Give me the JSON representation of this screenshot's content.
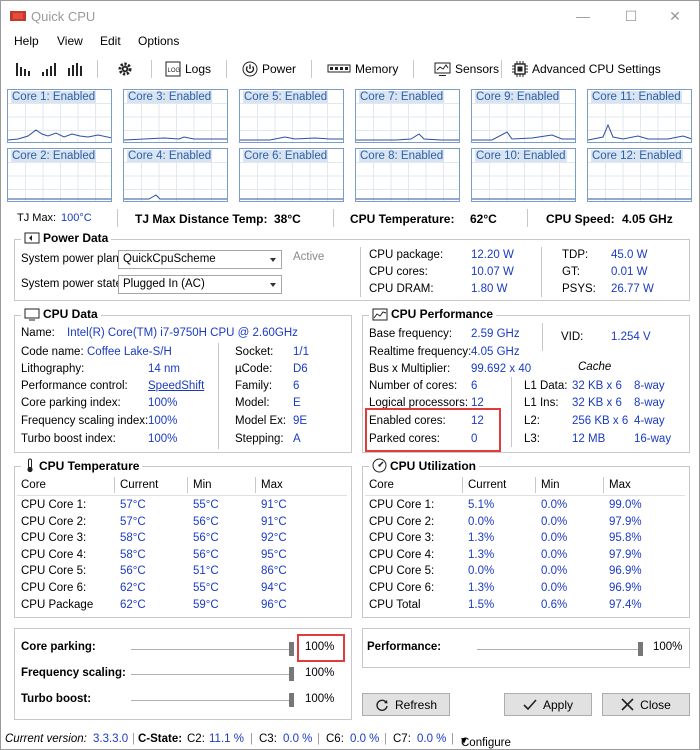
{
  "app": {
    "title": "Quick CPU"
  },
  "window_buttons": {
    "minimize": "—",
    "maximize": "☐",
    "close": "✕"
  },
  "menu": [
    "Help",
    "View",
    "Edit",
    "Options"
  ],
  "toolbar": {
    "logs": "Logs",
    "power": "Power",
    "memory": "Memory",
    "sensors": "Sensors",
    "advanced": "Advanced CPU Settings"
  },
  "cores": [
    {
      "label": "Core 1: Enabled"
    },
    {
      "label": "Core 3: Enabled"
    },
    {
      "label": "Core 5: Enabled"
    },
    {
      "label": "Core 7: Enabled"
    },
    {
      "label": "Core 9: Enabled"
    },
    {
      "label": "Core 11: Enabled"
    },
    {
      "label": "Core 2: Enabled"
    },
    {
      "label": "Core 4: Enabled"
    },
    {
      "label": "Core 6: Enabled"
    },
    {
      "label": "Core 8: Enabled"
    },
    {
      "label": "Core 10: Enabled"
    },
    {
      "label": "Core 12: Enabled"
    }
  ],
  "stats": {
    "tjmax_label": "TJ Max:",
    "tjmax_value": "100°C",
    "tjdist_label": "TJ Max Distance Temp:",
    "tjdist_value": "38°C",
    "cputemp_label": "CPU Temperature:",
    "cputemp_value": "62°C",
    "cpuspeed_label": "CPU Speed:",
    "cpuspeed_value": "4.05 GHz"
  },
  "power": {
    "title": "Power Data",
    "plan_label": "System power plan:",
    "plan_value": "QuickCpuScheme",
    "plan_status": "Active",
    "state_label": "System power state:",
    "state_value": "Plugged In (AC)",
    "pkg_label": "CPU package:",
    "pkg_value": "12.20 W",
    "cores_label": "CPU cores:",
    "cores_value": "10.07 W",
    "dram_label": "CPU DRAM:",
    "dram_value": "1.80 W",
    "tdp_label": "TDP:",
    "tdp_value": "45.0 W",
    "gt_label": "GT:",
    "gt_value": "0.01 W",
    "psys_label": "PSYS:",
    "psys_value": "26.77 W"
  },
  "cpudata": {
    "title": "CPU Data",
    "name_label": "Name:",
    "name_value": "Intel(R) Core(TM) i7-9750H CPU @ 2.60GHz",
    "codename_label": "Code name:",
    "codename_value": "Coffee Lake-S/H",
    "litho_label": "Lithography:",
    "litho_value": "14 nm",
    "perfctl_label": "Performance control:",
    "perfctl_value": "SpeedShift",
    "parkidx_label": "Core parking index:",
    "parkidx_value": "100%",
    "freqidx_label": "Frequency scaling index:",
    "freqidx_value": "100%",
    "turboidx_label": "Turbo boost index:",
    "turboidx_value": "100%",
    "socket_label": "Socket:",
    "socket_value": "1/1",
    "ucode_label": "µCode:",
    "ucode_value": "D6",
    "family_label": "Family:",
    "family_value": "6",
    "model_label": "Model:",
    "model_value": "E",
    "modelex_label": "Model Ex:",
    "modelex_value": "9E",
    "stepping_label": "Stepping:",
    "stepping_value": "A"
  },
  "perf": {
    "title": "CPU Performance",
    "basefreq_label": "Base frequency:",
    "basefreq_value": "2.59 GHz",
    "rtfreq_label": "Realtime frequency:",
    "rtfreq_value": "4.05 GHz",
    "bus_label": "Bus x Multiplier:",
    "bus_value": "99.692 x 40",
    "ncores_label": "Number of cores:",
    "ncores_value": "6",
    "logical_label": "Logical processors:",
    "logical_value": "12",
    "enabled_label": "Enabled cores:",
    "enabled_value": "12",
    "parked_label": "Parked cores:",
    "parked_value": "0",
    "vid_label": "VID:",
    "vid_value": "1.254 V",
    "cache_title": "Cache",
    "l1d_label": "L1 Data:",
    "l1d_size": "32 KB x 6",
    "l1d_way": "8-way",
    "l1i_label": "L1 Ins:",
    "l1i_size": "32 KB x 6",
    "l1i_way": "8-way",
    "l2_label": "L2:",
    "l2_size": "256 KB x 6",
    "l2_way": "4-way",
    "l3_label": "L3:",
    "l3_size": "12 MB",
    "l3_way": "16-way"
  },
  "temp": {
    "title": "CPU Temperature",
    "headers": [
      "Core",
      "Current",
      "Min",
      "Max"
    ],
    "rows": [
      [
        "CPU Core 1:",
        "57°C",
        "55°C",
        "91°C"
      ],
      [
        "CPU Core 2:",
        "57°C",
        "56°C",
        "91°C"
      ],
      [
        "CPU Core 3:",
        "58°C",
        "56°C",
        "92°C"
      ],
      [
        "CPU Core 4:",
        "58°C",
        "56°C",
        "95°C"
      ],
      [
        "CPU Core 5:",
        "56°C",
        "51°C",
        "86°C"
      ],
      [
        "CPU Core 6:",
        "62°C",
        "55°C",
        "94°C"
      ],
      [
        "CPU Package",
        "62°C",
        "59°C",
        "96°C"
      ]
    ]
  },
  "util": {
    "title": "CPU Utilization",
    "headers": [
      "Core",
      "Current",
      "Min",
      "Max"
    ],
    "rows": [
      [
        "CPU Core 1:",
        "5.1%",
        "0.0%",
        "99.0%"
      ],
      [
        "CPU Core 2:",
        "0.0%",
        "0.0%",
        "97.9%"
      ],
      [
        "CPU Core 3:",
        "1.3%",
        "0.0%",
        "95.8%"
      ],
      [
        "CPU Core 4:",
        "1.3%",
        "0.0%",
        "97.9%"
      ],
      [
        "CPU Core 5:",
        "0.0%",
        "0.0%",
        "96.9%"
      ],
      [
        "CPU Core 6:",
        "1.3%",
        "0.0%",
        "96.9%"
      ],
      [
        "CPU Total",
        "1.5%",
        "0.6%",
        "97.4%"
      ]
    ]
  },
  "controls": {
    "parking_label": "Core parking:",
    "parking_value": "100%",
    "freq_label": "Frequency scaling:",
    "freq_value": "100%",
    "turbo_label": "Turbo boost:",
    "turbo_value": "100%",
    "perf_label": "Performance:",
    "perf_value": "100%"
  },
  "buttons": {
    "refresh": "Refresh",
    "apply": "Apply",
    "close": "Close"
  },
  "status": {
    "version_label": "Current version:",
    "version_value": "3.3.3.0",
    "cstate_label": "C-State:",
    "c2_label": "C2:",
    "c2_value": "11.1 %",
    "c3_label": "C3:",
    "c3_value": "0.0 %",
    "c6_label": "C6:",
    "c6_value": "0.0 %",
    "c7_label": "C7:",
    "c7_value": "0.0 %",
    "configure": "Configure"
  }
}
